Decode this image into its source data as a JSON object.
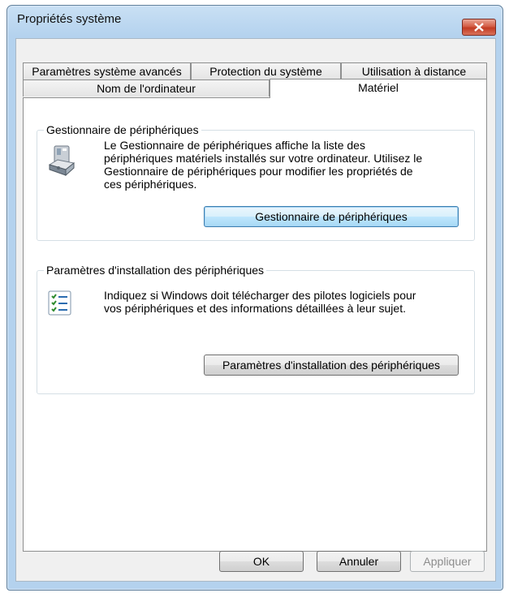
{
  "window": {
    "title": "Propriétés système"
  },
  "tabs": {
    "row1": [
      "Paramètres système avancés",
      "Protection du système",
      "Utilisation à distance"
    ],
    "row2": [
      "Nom de l'ordinateur",
      "Matériel"
    ],
    "active": "Matériel"
  },
  "device_manager": {
    "group_title": "Gestionnaire de périphériques",
    "description": [
      "Le Gestionnaire de périphériques affiche la liste des",
      "périphériques matériels installés sur votre ordinateur. Utilisez le",
      "Gestionnaire de périphériques pour modifier les propriétés de",
      "ces périphériques."
    ],
    "button_label": "Gestionnaire de périphériques",
    "icon": "device-manager-icon"
  },
  "install_settings": {
    "group_title": "Paramètres d'installation des périphériques",
    "description": [
      "Indiquez si Windows doit télécharger des pilotes logiciels pour",
      "vos périphériques et des informations détaillées à leur sujet."
    ],
    "button_label": "Paramètres d'installation des périphériques",
    "icon": "checklist-icon"
  },
  "footer": {
    "ok_label": "OK",
    "cancel_label": "Annuler",
    "apply_label": "Appliquer"
  },
  "colors": {
    "title_bar": "#b4d2ee",
    "close_button": "#c23b22",
    "focus": "#3c7fb1"
  }
}
